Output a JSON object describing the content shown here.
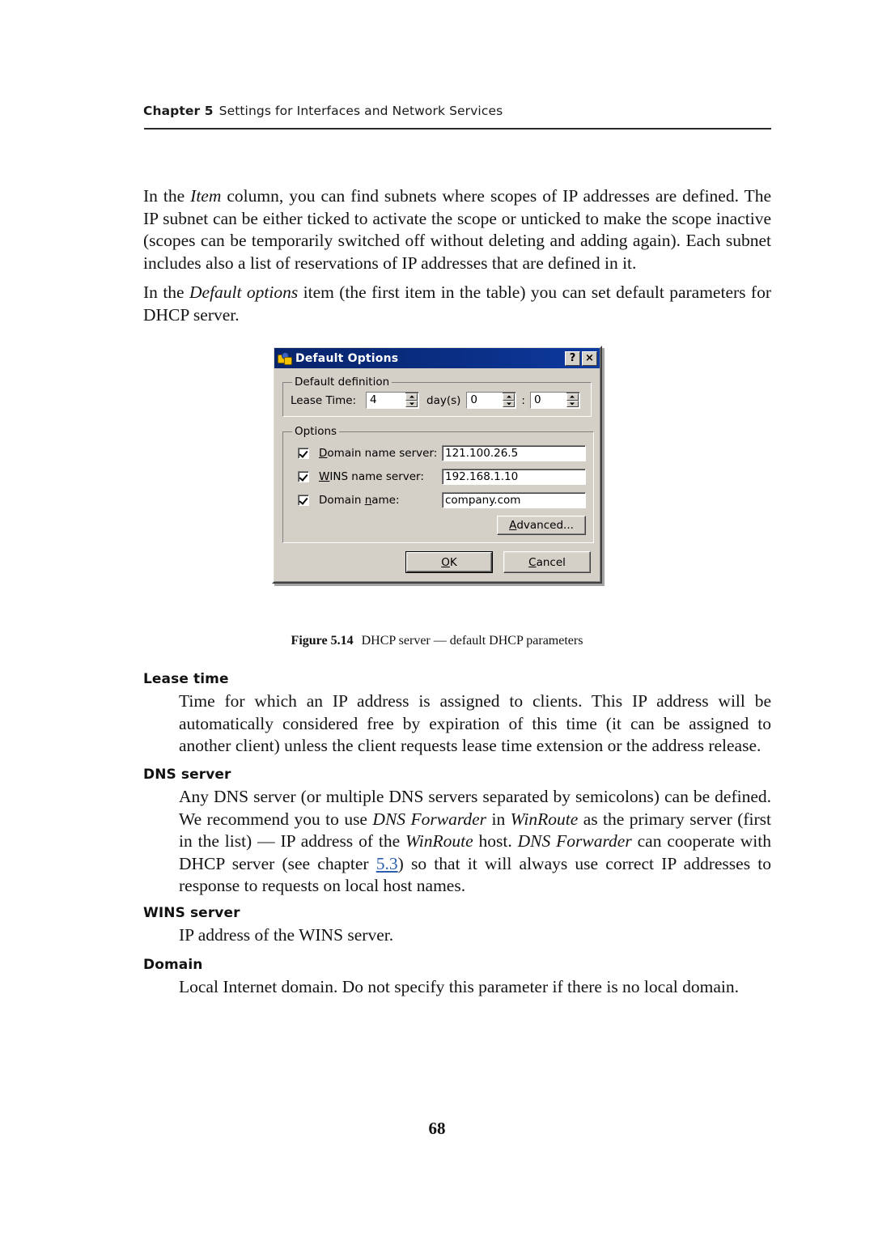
{
  "header": {
    "chapter": "Chapter 5",
    "title": "Settings for Interfaces and Network Services"
  },
  "paragraphs": {
    "p1_a": "In the ",
    "p1_italic": "Item",
    "p1_b": " column, you can find subnets where scopes of IP addresses are defined. The IP subnet can be either ticked to activate the scope or unticked to make the scope inactive (scopes can be temporarily switched off without deleting and adding again). Each subnet includes also a list of reservations of IP addresses that are defined in it.",
    "p2_a": "In the ",
    "p2_italic": "Default options",
    "p2_b": " item (the first item in the table) you can set default parameters for DHCP server."
  },
  "dialog": {
    "title": "Default Options",
    "icon": "dhcp-options-icon",
    "help_button": "?",
    "close_button": "×",
    "group_default_definition": {
      "legend": "Default definition",
      "lease_time_label": "Lease Time:",
      "days_value": "4",
      "days_unit": "day(s)",
      "hours_value": "0",
      "separator": ":",
      "minutes_value": "0"
    },
    "group_options": {
      "legend": "Options",
      "rows": [
        {
          "checked": true,
          "label_pre": "",
          "accel": "D",
          "label_post": "omain name server:",
          "value": "121.100.26.5"
        },
        {
          "checked": true,
          "label_pre": "",
          "accel": "W",
          "label_post": "INS name server:",
          "value": "192.168.1.10"
        },
        {
          "checked": true,
          "label_pre": "Domain ",
          "accel": "n",
          "label_post": "ame:",
          "value": "company.com"
        }
      ],
      "advanced_pre": "",
      "advanced_accel": "A",
      "advanced_post": "dvanced..."
    },
    "buttons": {
      "ok_accel": "O",
      "ok_post": "K",
      "cancel_accel": "C",
      "cancel_post": "ancel"
    }
  },
  "figure": {
    "number": "Figure 5.14",
    "text": "DHCP server — default DHCP parameters"
  },
  "sections": [
    {
      "term": "Lease time",
      "text": "Time for which an IP address is assigned to clients. This IP address will be automatically considered free by expiration of this time (it can be assigned to another client) unless the client requests lease time extension or the address release."
    },
    {
      "term": "WINS server",
      "text": "IP address of the WINS server."
    },
    {
      "term": "Domain",
      "text": "Local Internet domain. Do not specify this parameter if there is no local domain."
    }
  ],
  "dns_section": {
    "term": "DNS server",
    "t1": "Any DNS server (or multiple DNS servers separated by semicolons) can be defined. We recommend you to use ",
    "i1": "DNS Forwarder",
    "t2": " in ",
    "i2": "WinRoute",
    "t3": " as the primary server (first in the list) — IP address of the ",
    "i3": "WinRoute",
    "t4": " host. ",
    "i4": "DNS Forwarder",
    "t5": " can cooperate with DHCP server (see chapter ",
    "xref": "5.3",
    "t6": ") so that it will always use correct IP addresses to response to requests on local host names."
  },
  "folio": "68",
  "colors": {
    "xref": "#2b5fae",
    "titlebar": "#0a2f86",
    "dialog_face": "#d4d0c8"
  }
}
